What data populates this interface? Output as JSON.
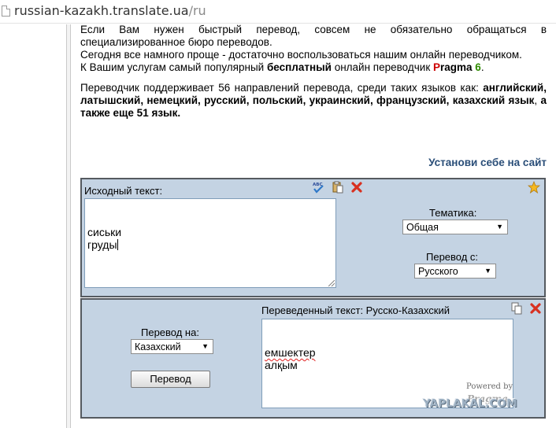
{
  "browser": {
    "url_host": "russian-kazakh.translate.ua",
    "url_path": "/ru"
  },
  "intro": {
    "p1": "Если Вам нужен быстрый перевод, совсем не обязательно обращаться в специализированное бюро переводов.",
    "p2": "Сегодня все намного проще - достаточно воспользоваться нашим онлайн переводчиком.",
    "p3_before": "К Вашим услугам самый популярный ",
    "p3_bold": "бесплатный",
    "p3_middle": " онлайн переводчик ",
    "p3_brand_p": "P",
    "p3_brand_rest": "ragma",
    "p3_brand_num": "6",
    "p3_end": ".",
    "p4_before": "Переводчик поддерживает 56 направлений перевода, среди таких языков как: ",
    "p4_languages": "английский, латышский, немецкий, русский, польский, украинский, французский, казахский язык",
    "p4_comma": ", ",
    "p4_bold_end": "а также еще 51 язык."
  },
  "install_link": "Установи себе на сайт",
  "source_panel": {
    "label": "Исходный текст:",
    "text_lines": [
      "сиськи",
      "груды"
    ],
    "topic_label": "Тематика:",
    "topic_value": "Общая",
    "from_label": "Перевод с:",
    "from_value": "Русского"
  },
  "target_panel": {
    "to_label": "Перевод на:",
    "to_value": "Казахский",
    "translate_button": "Перевод",
    "result_label": "Переведенный текст: Русско-Казахский",
    "result_lines": [
      "емшектер",
      "алқым"
    ],
    "powered_by": "Powered by",
    "logo_text": "Pragma"
  },
  "watermark": "YAPLAKAL.COM",
  "colors": {
    "panel_bg": "#c4d3e3",
    "panel_border": "#555a60",
    "brand_red": "#cc0000",
    "brand_green": "#2e8b00",
    "link_blue": "#2a4e78"
  },
  "icons": [
    "page-icon",
    "spellcheck-icon",
    "paste-icon",
    "clear-icon",
    "star-icon",
    "copy-icon",
    "close-icon"
  ]
}
